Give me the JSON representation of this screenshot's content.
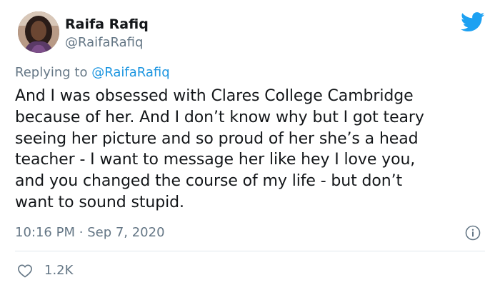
{
  "tweet": {
    "display_name": "Raifa Rafiq",
    "handle": "@RaifaRafiq",
    "replying_prefix": "Replying to",
    "replying_mention": "@RaifaRafiq",
    "body_lines": [
      "And I was obsessed with Clares College Cambridge",
      "because of her. And I don’t know why but I got teary",
      "seeing her picture and so proud of her she’s a head",
      "teacher - I want to message her like hey I love you,",
      "and you changed the course of my life - but don’t",
      "want to sound stupid."
    ],
    "time": "10:16 PM",
    "separator": "·",
    "date": "Sep 7, 2020",
    "like_count": "1.2K"
  },
  "icons": {
    "brand": "twitter-bird-icon",
    "info": "info-icon",
    "like": "heart-icon"
  },
  "colors": {
    "twitter_blue": "#1da1f2",
    "mention_blue": "#1b95e0",
    "text_primary": "#14171a",
    "text_secondary": "#657786",
    "divider": "#e1e8ed"
  }
}
